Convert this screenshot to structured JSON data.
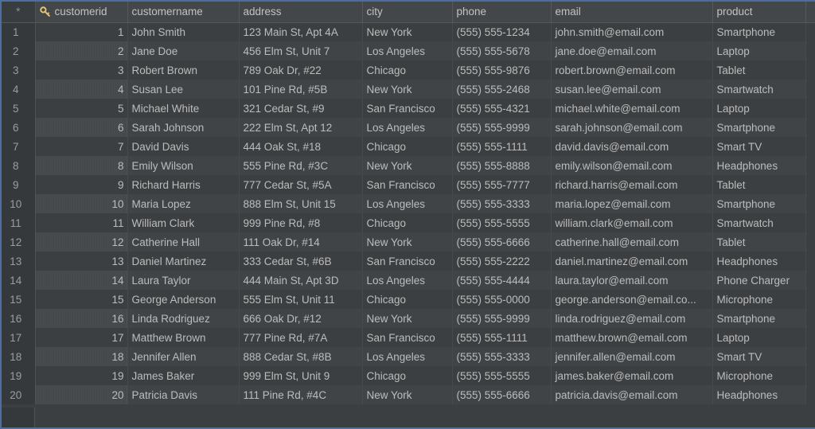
{
  "grid": {
    "row_header_label": "*",
    "pk_icon": "key-icon",
    "accent_color": "#4a6fa0",
    "header_bg": "#44474a",
    "row_bg_odd": "#3c3f41",
    "row_bg_even": "#414447",
    "text_color": "#bcbcbc",
    "key_icon_color": "#e8c46a",
    "columns": [
      {
        "key": "customerid",
        "label": "customerid",
        "align": "right",
        "primary_key": true
      },
      {
        "key": "customername",
        "label": "customername",
        "align": "left",
        "primary_key": false
      },
      {
        "key": "address",
        "label": "address",
        "align": "left",
        "primary_key": false
      },
      {
        "key": "city",
        "label": "city",
        "align": "left",
        "primary_key": false
      },
      {
        "key": "phone",
        "label": "phone",
        "align": "left",
        "primary_key": false
      },
      {
        "key": "email",
        "label": "email",
        "align": "left",
        "primary_key": false
      },
      {
        "key": "product",
        "label": "product",
        "align": "left",
        "primary_key": false
      }
    ],
    "row_count": 20,
    "rows": [
      {
        "n": "1",
        "customerid": "1",
        "customername": "John Smith",
        "address": "123 Main St, Apt 4A",
        "city": "New York",
        "phone": "(555) 555-1234",
        "email": "john.smith@email.com",
        "product": "Smartphone"
      },
      {
        "n": "2",
        "customerid": "2",
        "customername": "Jane Doe",
        "address": "456 Elm St, Unit 7",
        "city": "Los Angeles",
        "phone": "(555) 555-5678",
        "email": "jane.doe@email.com",
        "product": "Laptop"
      },
      {
        "n": "3",
        "customerid": "3",
        "customername": "Robert Brown",
        "address": "789 Oak Dr, #22",
        "city": "Chicago",
        "phone": "(555) 555-9876",
        "email": "robert.brown@email.com",
        "product": "Tablet"
      },
      {
        "n": "4",
        "customerid": "4",
        "customername": "Susan Lee",
        "address": "101 Pine Rd, #5B",
        "city": "New York",
        "phone": "(555) 555-2468",
        "email": "susan.lee@email.com",
        "product": "Smartwatch"
      },
      {
        "n": "5",
        "customerid": "5",
        "customername": "Michael White",
        "address": "321 Cedar St, #9",
        "city": "San Francisco",
        "phone": "(555) 555-4321",
        "email": "michael.white@email.com",
        "product": "Laptop"
      },
      {
        "n": "6",
        "customerid": "6",
        "customername": "Sarah Johnson",
        "address": "222 Elm St, Apt 12",
        "city": "Los Angeles",
        "phone": "(555) 555-9999",
        "email": "sarah.johnson@email.com",
        "product": "Smartphone"
      },
      {
        "n": "7",
        "customerid": "7",
        "customername": "David Davis",
        "address": "444 Oak St, #18",
        "city": "Chicago",
        "phone": "(555) 555-1111",
        "email": "david.davis@email.com",
        "product": "Smart TV"
      },
      {
        "n": "8",
        "customerid": "8",
        "customername": "Emily Wilson",
        "address": "555 Pine Rd, #3C",
        "city": "New York",
        "phone": "(555) 555-8888",
        "email": "emily.wilson@email.com",
        "product": "Headphones"
      },
      {
        "n": "9",
        "customerid": "9",
        "customername": "Richard Harris",
        "address": "777 Cedar St, #5A",
        "city": "San Francisco",
        "phone": "(555) 555-7777",
        "email": "richard.harris@email.com",
        "product": "Tablet"
      },
      {
        "n": "10",
        "customerid": "10",
        "customername": "Maria Lopez",
        "address": "888 Elm St, Unit 15",
        "city": "Los Angeles",
        "phone": "(555) 555-3333",
        "email": "maria.lopez@email.com",
        "product": "Smartphone"
      },
      {
        "n": "11",
        "customerid": "11",
        "customername": "William Clark",
        "address": "999 Pine Rd, #8",
        "city": "Chicago",
        "phone": "(555) 555-5555",
        "email": "william.clark@email.com",
        "product": "Smartwatch"
      },
      {
        "n": "12",
        "customerid": "12",
        "customername": "Catherine Hall",
        "address": "111 Oak Dr, #14",
        "city": "New York",
        "phone": "(555) 555-6666",
        "email": "catherine.hall@email.com",
        "product": "Tablet"
      },
      {
        "n": "13",
        "customerid": "13",
        "customername": "Daniel Martinez",
        "address": "333 Cedar St, #6B",
        "city": "San Francisco",
        "phone": "(555) 555-2222",
        "email": "daniel.martinez@email.com",
        "product": "Headphones"
      },
      {
        "n": "14",
        "customerid": "14",
        "customername": "Laura Taylor",
        "address": "444 Main St, Apt 3D",
        "city": "Los Angeles",
        "phone": "(555) 555-4444",
        "email": "laura.taylor@email.com",
        "product": "Phone Charger"
      },
      {
        "n": "15",
        "customerid": "15",
        "customername": "George Anderson",
        "address": "555 Elm St, Unit 11",
        "city": "Chicago",
        "phone": "(555) 555-0000",
        "email": "george.anderson@email.co...",
        "product": "Microphone"
      },
      {
        "n": "16",
        "customerid": "16",
        "customername": "Linda Rodriguez",
        "address": "666 Oak Dr, #12",
        "city": "New York",
        "phone": "(555) 555-9999",
        "email": "linda.rodriguez@email.com",
        "product": "Smartphone"
      },
      {
        "n": "17",
        "customerid": "17",
        "customername": "Matthew Brown",
        "address": "777 Pine Rd, #7A",
        "city": "San Francisco",
        "phone": "(555) 555-1111",
        "email": "matthew.brown@email.com",
        "product": "Laptop"
      },
      {
        "n": "18",
        "customerid": "18",
        "customername": "Jennifer Allen",
        "address": "888 Cedar St, #8B",
        "city": "Los Angeles",
        "phone": "(555) 555-3333",
        "email": "jennifer.allen@email.com",
        "product": "Smart TV"
      },
      {
        "n": "19",
        "customerid": "19",
        "customername": "James Baker",
        "address": "999 Elm St, Unit 9",
        "city": "Chicago",
        "phone": "(555) 555-5555",
        "email": "james.baker@email.com",
        "product": "Microphone"
      },
      {
        "n": "20",
        "customerid": "20",
        "customername": "Patricia Davis",
        "address": "111 Pine Rd, #4C",
        "city": "New York",
        "phone": "(555) 555-6666",
        "email": "patricia.davis@email.com",
        "product": "Headphones"
      }
    ]
  }
}
